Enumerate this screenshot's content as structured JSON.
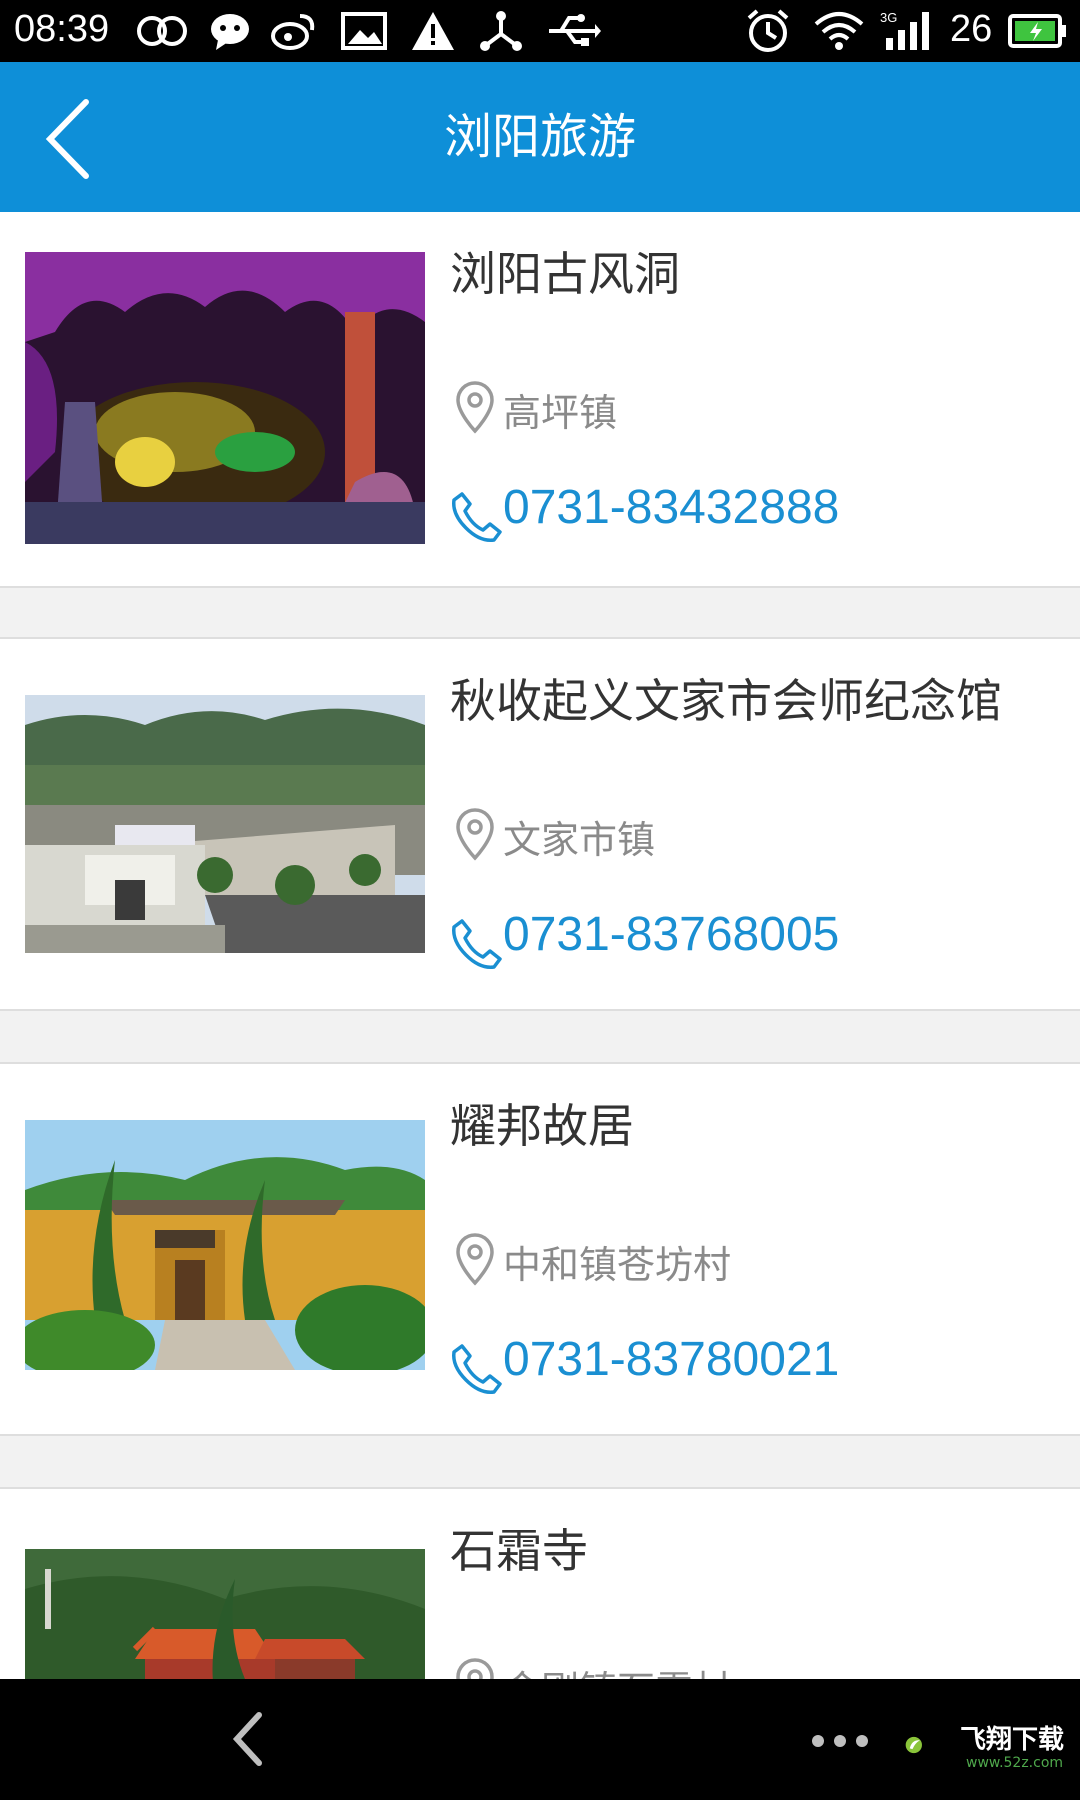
{
  "status_bar": {
    "time": "08:39",
    "battery_level": "26",
    "icons": [
      "infinity-icon",
      "chat-bubble-icon",
      "weibo-icon",
      "image-icon",
      "warning-icon",
      "network-icon",
      "usb-icon",
      "alarm-icon",
      "wifi-icon",
      "signal-3g-icon",
      "battery-charging-icon"
    ]
  },
  "app_bar": {
    "title": "浏阳旅游",
    "back_icon": "chevron-left-icon"
  },
  "places": [
    {
      "name": "浏阳古风洞",
      "location": "高坪镇",
      "phone": "0731-83432888"
    },
    {
      "name": "秋收起义文家市会师纪念馆",
      "location": "文家市镇",
      "phone": "0731-83768005"
    },
    {
      "name": "耀邦故居",
      "location": "中和镇苍坊村",
      "phone": "0731-83780021"
    },
    {
      "name": "石霜寺",
      "location": "金刚镇石霜村",
      "phone": ""
    }
  ],
  "nav_bar": {
    "back_icon": "back-arrow-icon",
    "more_icon": "more-dots-icon"
  },
  "watermark": {
    "text": "飞翔下载",
    "subtext": "www.52z.com"
  },
  "colors": {
    "app_bar": "#0e8fd8",
    "phone_text": "#1a8fd2",
    "location_text": "#8a8a8a",
    "title_text": "#333333"
  }
}
